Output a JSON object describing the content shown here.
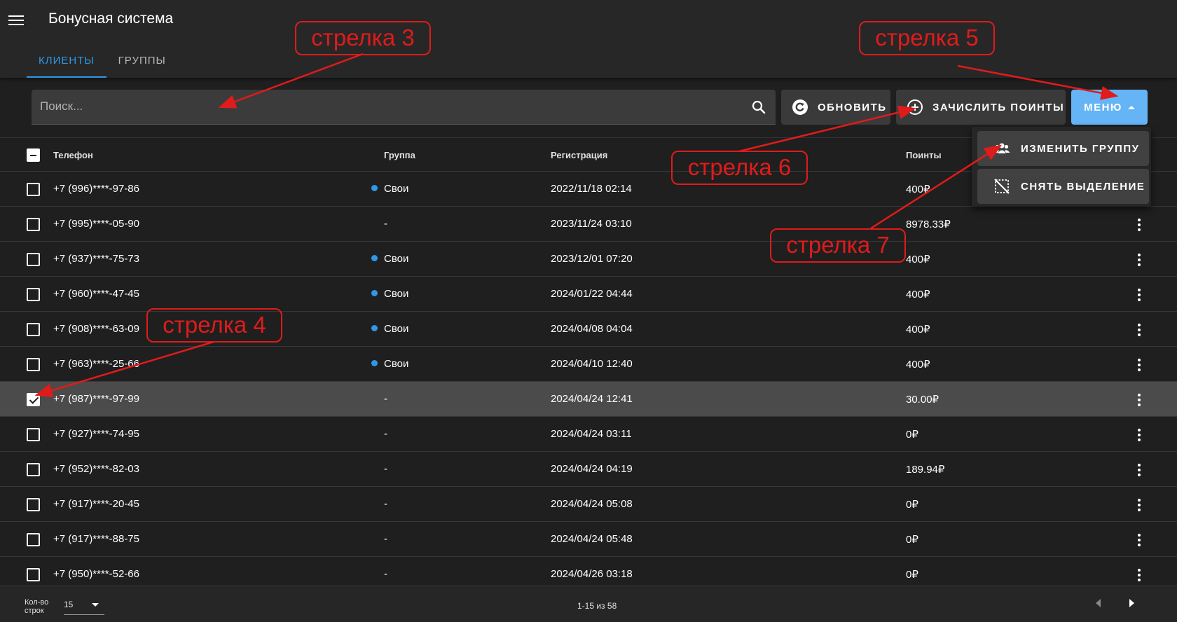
{
  "app": {
    "title": "Бонусная система"
  },
  "tabs": [
    {
      "label": "КЛИЕНТЫ",
      "active": true
    },
    {
      "label": "ГРУППЫ",
      "active": false
    }
  ],
  "toolbar": {
    "search_placeholder": "Поиск...",
    "refresh_label": "ОБНОВИТЬ",
    "credit_label": "ЗАЧИСЛИТЬ ПОИНТЫ",
    "menu_label": "МЕНЮ"
  },
  "menu_dropdown": {
    "change_group_label": "ИЗМЕНИТЬ ГРУППУ",
    "clear_selection_label": "СНЯТЬ ВЫДЕЛЕНИЕ"
  },
  "table": {
    "columns": {
      "phone": "Телефон",
      "group": "Группа",
      "registration": "Регистрация",
      "points": "Поинты"
    },
    "rows": [
      {
        "phone": "+7 (996)****-97-86",
        "group": "Свои",
        "registered": "2022/11/18 02:14",
        "points": "400₽",
        "checked": false
      },
      {
        "phone": "+7 (995)****-05-90",
        "group": "-",
        "registered": "2023/11/24 03:10",
        "points": "8978.33₽",
        "checked": false
      },
      {
        "phone": "+7 (937)****-75-73",
        "group": "Свои",
        "registered": "2023/12/01 07:20",
        "points": "400₽",
        "checked": false
      },
      {
        "phone": "+7 (960)****-47-45",
        "group": "Свои",
        "registered": "2024/01/22 04:44",
        "points": "400₽",
        "checked": false
      },
      {
        "phone": "+7 (908)****-63-09",
        "group": "Свои",
        "registered": "2024/04/08 04:04",
        "points": "400₽",
        "checked": false
      },
      {
        "phone": "+7 (963)****-25-66",
        "group": "Свои",
        "registered": "2024/04/10 12:40",
        "points": "400₽",
        "checked": false
      },
      {
        "phone": "+7 (987)****-97-99",
        "group": "-",
        "registered": "2024/04/24 12:41",
        "points": "30.00₽",
        "checked": true
      },
      {
        "phone": "+7 (927)****-74-95",
        "group": "-",
        "registered": "2024/04/24 03:11",
        "points": "0₽",
        "checked": false
      },
      {
        "phone": "+7 (952)****-82-03",
        "group": "-",
        "registered": "2024/04/24 04:19",
        "points": "189.94₽",
        "checked": false
      },
      {
        "phone": "+7 (917)****-20-45",
        "group": "-",
        "registered": "2024/04/24 05:08",
        "points": "0₽",
        "checked": false
      },
      {
        "phone": "+7 (917)****-88-75",
        "group": "-",
        "registered": "2024/04/24 05:48",
        "points": "0₽",
        "checked": false
      },
      {
        "phone": "+7 (950)****-52-66",
        "group": "-",
        "registered": "2024/04/26 03:18",
        "points": "0₽",
        "checked": false
      }
    ]
  },
  "footer": {
    "rows_per_page_label": "Кол-во строк",
    "rows_per_page_value": "15",
    "pagination_info": "1-15 из 58"
  },
  "annotations": [
    {
      "label": "стрелка 3"
    },
    {
      "label": "стрелка 5"
    },
    {
      "label": "стрелка 6"
    },
    {
      "label": "стрелка 4"
    },
    {
      "label": "стрелка 7"
    }
  ],
  "colors": {
    "accent": "#2f98e8",
    "menu_button": "#64b4f6",
    "annotation": "#e01b1b",
    "background": "#1f1f1f"
  }
}
